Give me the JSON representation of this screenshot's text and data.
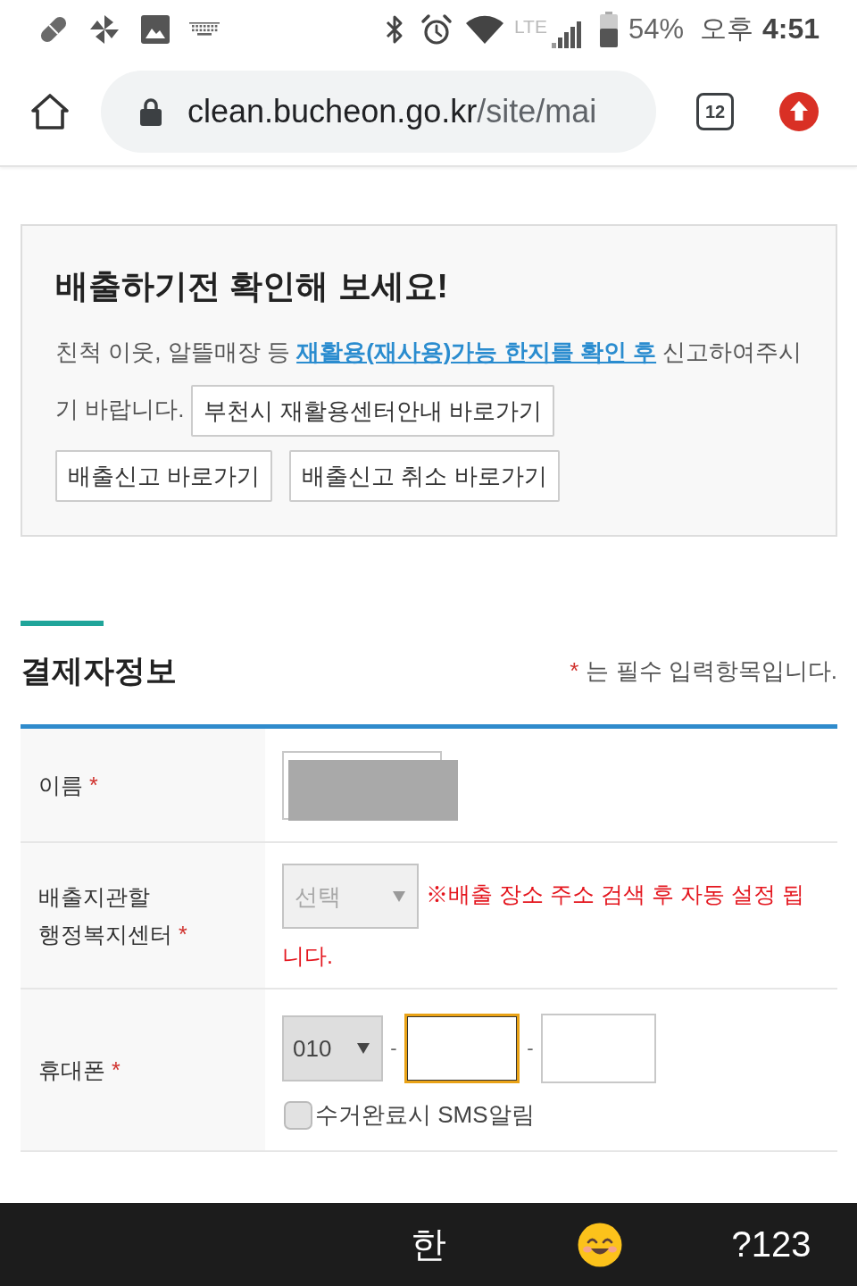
{
  "status_bar": {
    "network": "LTE",
    "battery": "54%",
    "period": "오후",
    "time": "4:51"
  },
  "browser": {
    "domain": "clean.bucheon.go.kr",
    "path": "/site/mai",
    "tab_count": "12"
  },
  "notice": {
    "title": "배출하기전 확인해 보세요!",
    "text_before": "친척 이웃, 알뜰매장 등 ",
    "link": "재활용(재사용)가능 한지를 확인 후",
    "text_after": " 신고하여주시기 바랍니다.",
    "buttons": [
      "부천시 재활용센터안내 바로가기",
      "배출신고 바로가기",
      "배출신고 취소 바로가기"
    ]
  },
  "section": {
    "title": "결제자정보",
    "required_mark": "*",
    "required_note": "는 필수 입력항목입니다."
  },
  "rows": [
    {
      "kind": "name",
      "label": "이름",
      "mark": "*",
      "redacted": true
    },
    {
      "kind": "select",
      "label": "배출지관할 행정복지센터",
      "mark": "*",
      "select": {
        "value": "선택",
        "disabled": true
      },
      "note": "※배출 장소 주소 검색 후 자동 설정 됩니다."
    },
    {
      "kind": "phone",
      "label": "휴대폰",
      "mark": "*",
      "prefix": {
        "value": "010",
        "disabled": false
      },
      "separators": [
        "-",
        "-"
      ],
      "fields": [
        {
          "focused": true
        },
        {
          "focused": false
        }
      ],
      "checkbox": {
        "label": "수거완료시 SMS알림",
        "checked": false
      }
    }
  ],
  "keyboard": {
    "keys": [
      {
        "kind": "text",
        "label": "한"
      },
      {
        "kind": "emoji"
      },
      {
        "kind": "text",
        "label": "?123"
      }
    ]
  }
}
